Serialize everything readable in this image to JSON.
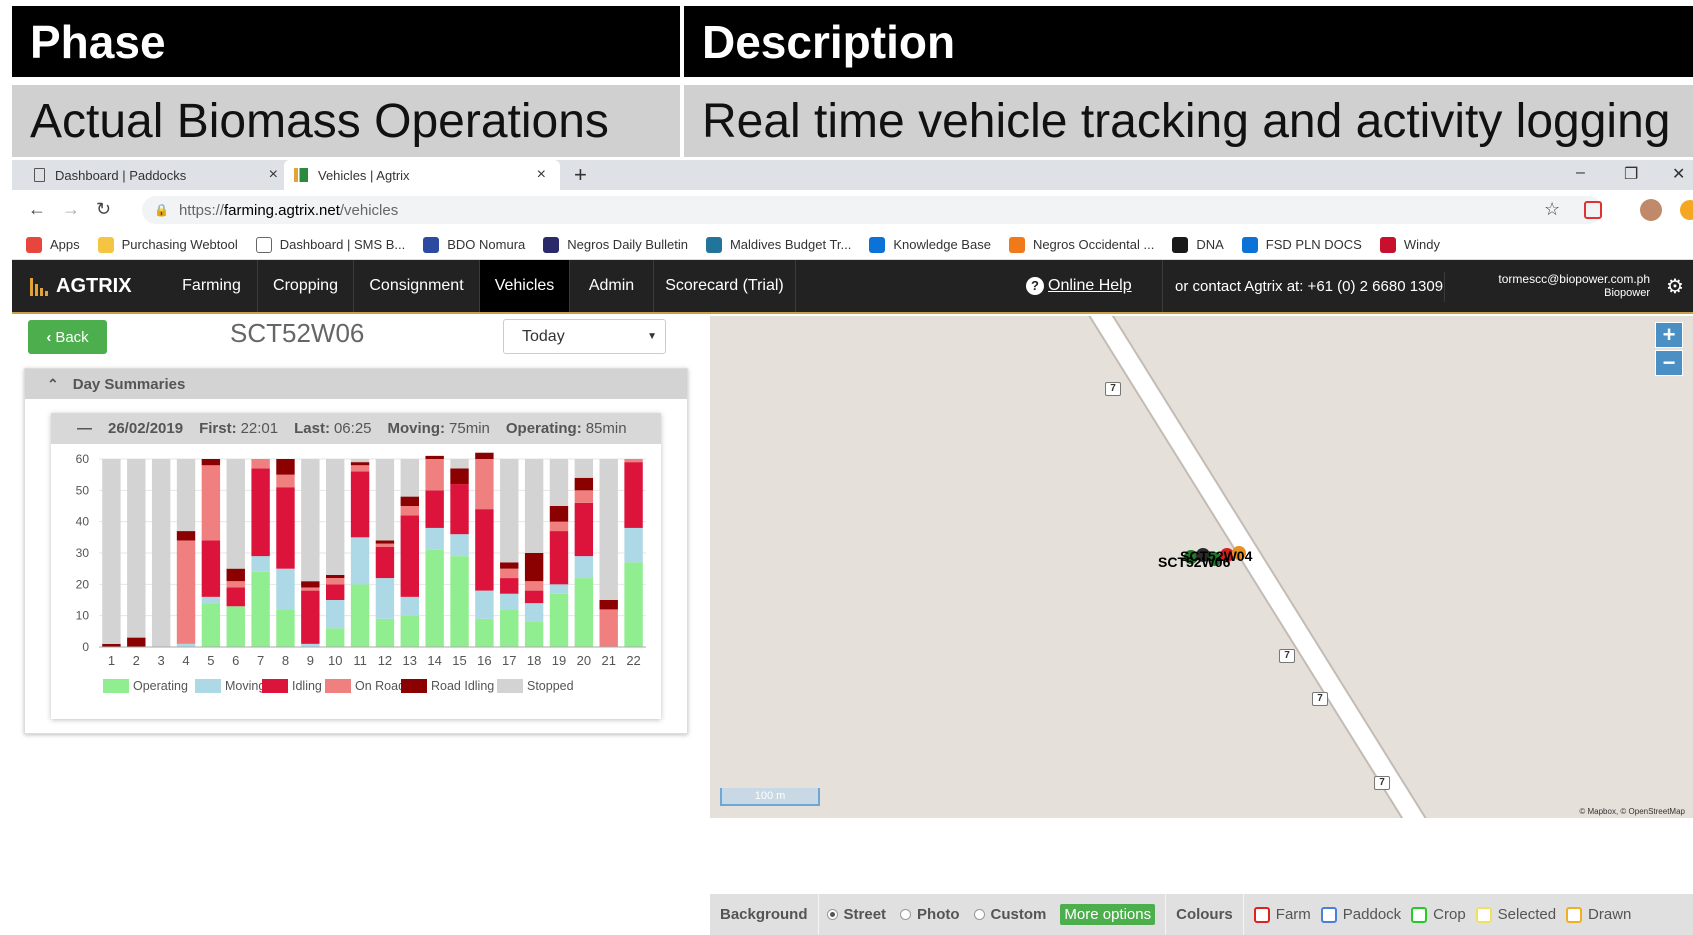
{
  "slide": {
    "header": {
      "phase": "Phase",
      "description": "Description"
    },
    "row": {
      "phase": "Actual Biomass Operations",
      "description": "Real time vehicle tracking and activity logging"
    }
  },
  "browser": {
    "tabs": [
      {
        "title": "Dashboard | Paddocks",
        "close": "×"
      },
      {
        "title": "Vehicles | Agtrix",
        "close": "×"
      }
    ],
    "new_tab": "+",
    "window_controls": {
      "minimize": "–",
      "restore": "❐",
      "close": "✕"
    },
    "nav": {
      "back": "←",
      "forward": "→",
      "reload": "↻"
    },
    "url_prefix": "https://",
    "url_host": "farming.agtrix.net",
    "url_path": "/vehicles",
    "star": "☆",
    "bookmarks": [
      {
        "label": "Apps",
        "color": "#e8453c"
      },
      {
        "label": "Purchasing Webtool",
        "color": "#f4c542"
      },
      {
        "label": "Dashboard | SMS B...",
        "color": "#ffffff"
      },
      {
        "label": "BDO Nomura",
        "color": "#2b4aa0"
      },
      {
        "label": "Negros Daily Bulletin",
        "color": "#2a2a6a"
      },
      {
        "label": "Maldives Budget Tr...",
        "color": "#21759b"
      },
      {
        "label": "Knowledge Base",
        "color": "#0b73d8"
      },
      {
        "label": "Negros Occidental ...",
        "color": "#f07a1a"
      },
      {
        "label": "DNA",
        "color": "#1a1a1a"
      },
      {
        "label": "FSD PLN DOCS",
        "color": "#0b73d8"
      },
      {
        "label": "Windy",
        "color": "#c8102e"
      }
    ]
  },
  "app": {
    "logo": "AGTRIX",
    "nav": [
      "Farming",
      "Cropping",
      "Consignment",
      "Vehicles",
      "Admin",
      "Scorecard (Trial)"
    ],
    "active_nav": "Vehicles",
    "help": "Online Help",
    "contact": "or contact Agtrix at: +61 (0) 2 6680 1309",
    "user_email": "tormescc@biopower.com.ph",
    "user_org": "Biopower"
  },
  "vehicle": {
    "back_label": "Back",
    "name": "SCT52W06",
    "period": "Today",
    "section_title": "Day Summaries",
    "summary": {
      "date": "26/02/2019",
      "first_label": "First:",
      "first": "22:01",
      "last_label": "Last:",
      "last": "06:25",
      "moving_label": "Moving:",
      "moving": "75min",
      "operating_label": "Operating:",
      "operating": "85min"
    }
  },
  "chart_data": {
    "type": "bar",
    "stacked": true,
    "categories": [
      "1",
      "2",
      "3",
      "4",
      "5",
      "6",
      "7",
      "8",
      "9",
      "10",
      "11",
      "12",
      "13",
      "14",
      "15",
      "16",
      "17",
      "18",
      "19",
      "20",
      "21",
      "22"
    ],
    "ylim": [
      0,
      60
    ],
    "yticks": [
      0,
      10,
      20,
      30,
      40,
      50,
      60
    ],
    "legend_position": "bottom",
    "series": [
      {
        "name": "Operating",
        "color": "#90ee90",
        "values": [
          0,
          0,
          0,
          0,
          14,
          13,
          24,
          12,
          0,
          6,
          20,
          9,
          10,
          31,
          29,
          9,
          12,
          8,
          17,
          22,
          0,
          27
        ]
      },
      {
        "name": "Moving",
        "color": "#add8e6",
        "values": [
          0,
          0,
          0,
          1,
          2,
          0,
          5,
          13,
          1,
          9,
          15,
          13,
          6,
          7,
          7,
          9,
          5,
          6,
          3,
          7,
          0,
          11
        ]
      },
      {
        "name": "Idling",
        "color": "#dc143c",
        "values": [
          0,
          0,
          0,
          0,
          18,
          6,
          28,
          26,
          17,
          5,
          21,
          10,
          26,
          12,
          16,
          26,
          5,
          4,
          17,
          17,
          0,
          21
        ]
      },
      {
        "name": "On Road",
        "color": "#f08080",
        "values": [
          0,
          0,
          0,
          33,
          24,
          2,
          3,
          4,
          1,
          2,
          2,
          1,
          3,
          10,
          0,
          16,
          3,
          3,
          3,
          4,
          12,
          1
        ]
      },
      {
        "name": "Road Idling",
        "color": "#8b0000",
        "values": [
          1,
          3,
          0,
          3,
          2,
          4,
          0,
          5,
          2,
          1,
          1,
          1,
          3,
          1,
          5,
          2,
          2,
          9,
          5,
          4,
          3,
          0
        ]
      },
      {
        "name": "Stopped",
        "color": "#d3d3d3",
        "values": [
          59,
          57,
          60,
          23,
          0,
          35,
          0,
          0,
          39,
          37,
          1,
          26,
          12,
          0,
          3,
          0,
          33,
          30,
          15,
          6,
          45,
          0
        ]
      }
    ]
  },
  "map": {
    "zoom_in": "+",
    "zoom_out": "−",
    "road_ref": "7",
    "marker_labels": [
      "SCT52W04",
      "SCT52W06"
    ],
    "scale": "100 m",
    "attribution": "© Mapbox, © OpenStreetMap"
  },
  "controls": {
    "background_label": "Background",
    "options": [
      "Street",
      "Photo",
      "Custom"
    ],
    "selected": "Street",
    "more_options": "More options",
    "colours_label": "Colours",
    "colour_keys": [
      {
        "label": "Farm",
        "color": "#d22"
      },
      {
        "label": "Paddock",
        "color": "#4a7fe0"
      },
      {
        "label": "Crop",
        "color": "#2c2"
      },
      {
        "label": "Selected",
        "color": "#f0e060"
      },
      {
        "label": "Drawn",
        "color": "#f0b020"
      }
    ]
  }
}
